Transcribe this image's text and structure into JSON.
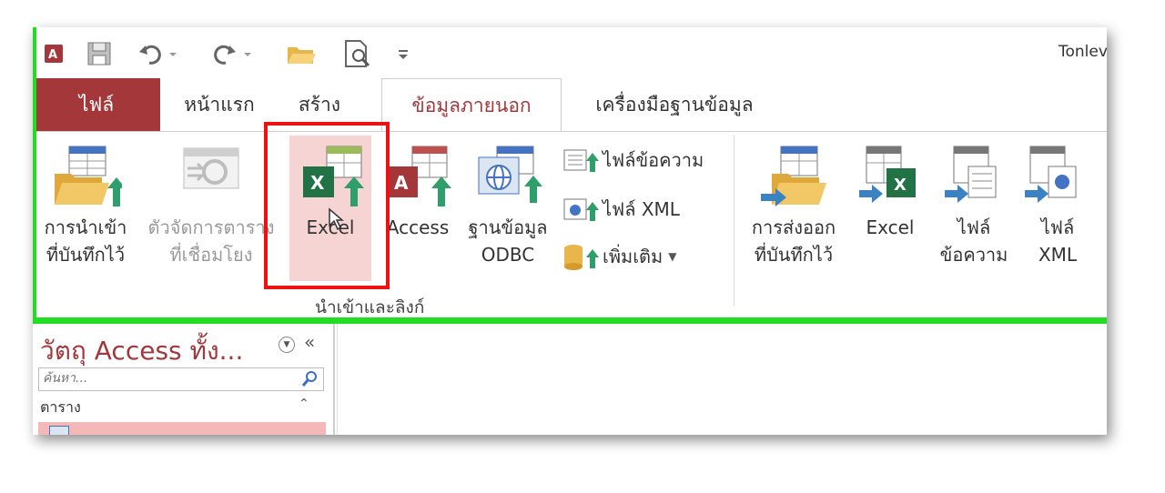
{
  "window": {
    "title_partial": "Tonlev"
  },
  "tabs": {
    "file": "ไฟล์",
    "home": "หน้าแรก",
    "create": "สร้าง",
    "external": "ข้อมูลภายนอก",
    "dbtools": "เครื่องมือฐานข้อมูล"
  },
  "ribbon": {
    "import_saved": {
      "line1": "การนำเข้า",
      "line2": "ที่บันทึกไว้"
    },
    "linked_table_manager": {
      "line1": "ตัวจัดการตาราง",
      "line2": "ที่เชื่อมโยง"
    },
    "excel_import": "Excel",
    "access_import": "Access",
    "odbc": {
      "line1": "ฐานข้อมูล",
      "line2": "ODBC"
    },
    "text_file": "ไฟล์ข้อความ",
    "xml_file": "ไฟล์ XML",
    "more": "เพิ่มเติม",
    "group_label": "นำเข้าและลิงก์",
    "export_saved": {
      "line1": "การส่งออก",
      "line2": "ที่บันทึกไว้"
    },
    "excel_export": "Excel",
    "text_export": {
      "line1": "ไฟล์",
      "line2": "ข้อความ"
    },
    "xml_export": {
      "line1": "ไฟล์",
      "line2": "XML"
    }
  },
  "nav": {
    "title": "วัตถุ Access ทั้ง...",
    "search_placeholder": "ค้นหา...",
    "group": "ตาราง"
  },
  "colors": {
    "access_red": "#a4373a",
    "excel_green": "#217346",
    "highlight_green": "#22dd22",
    "callout_red": "#ee1111"
  }
}
